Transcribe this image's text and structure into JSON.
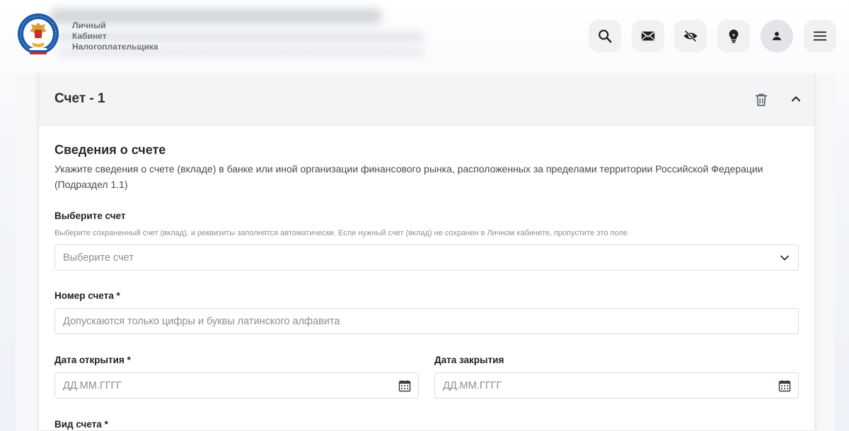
{
  "header": {
    "logo_text": "Личный\nКабинет\nНалогоплательщика",
    "logo_ring_text": "ФЕДЕРАЛЬНАЯ НАЛОГОВАЯ СЛУЖБА",
    "icons": [
      "search-icon",
      "mail-icon",
      "eye-off-icon",
      "lightbulb-icon",
      "user-icon",
      "menu-icon"
    ]
  },
  "card": {
    "title": "Счет - 1",
    "section_title": "Сведения о счете",
    "section_desc": "Укажите сведения о счете (вкладе) в банке или иной организации финансового рынка, расположенных за пределами территории Российской Федерации (Подраздел 1.1)",
    "select_account": {
      "label": "Выберите счет",
      "hint": "Выберите сохраненный счет (вклад), и реквизиты заполнятся автоматически. Если нужный счет (вклад) не сохранен в Личном кабинете, пропустите это поле",
      "placeholder": "Выберите счет"
    },
    "account_number": {
      "label": "Номер счета *",
      "placeholder": "Допускаются только цифры и буквы латинского алфавита"
    },
    "open_date": {
      "label": "Дата открытия *",
      "placeholder": "ДД.ММ.ГГГГ"
    },
    "close_date": {
      "label": "Дата закрытия",
      "placeholder": "ДД.ММ.ГГГГ"
    },
    "account_type": {
      "label": "Вид счета *"
    }
  },
  "colors": {
    "text": "#1f1f1f",
    "muted": "#8a8f97",
    "border": "#d9dce1",
    "header_btn": "#f0f1f3",
    "card_head": "#f3f4f6"
  }
}
